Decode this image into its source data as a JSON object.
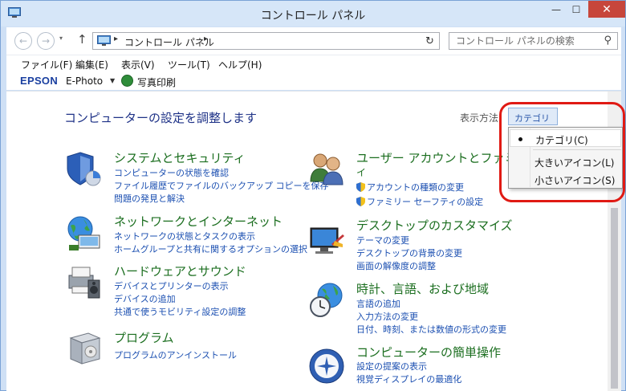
{
  "window": {
    "title": "コントロール パネル"
  },
  "title_buttons": {
    "minimize": "—",
    "maximize": "☐",
    "close": "✕"
  },
  "nav": {
    "back": "←",
    "forward": "→",
    "dropdown": "▾",
    "up": "↑",
    "refresh": "↻"
  },
  "address": {
    "sep": "▸",
    "crumb": "コントロール パネル",
    "dropdown": "▾"
  },
  "search": {
    "placeholder": "コントロール パネルの検索",
    "icon": "⚲"
  },
  "menu": [
    "ファイル(F)",
    "編集(E)",
    "表示(V)",
    "ツール(T)",
    "ヘルプ(H)"
  ],
  "epson": {
    "logo": "EPSON",
    "app": "E-Photo",
    "dropdown": "▼",
    "print": "写真印刷"
  },
  "content": {
    "title": "コンピューターの設定を調整します",
    "view_label": "表示方法:",
    "view_value": "カテゴリ",
    "view_arrow": "▼"
  },
  "categories": {
    "system": {
      "title": "システムとセキュリティ",
      "links": [
        "コンピューターの状態を確認",
        "ファイル履歴でファイルのバックアップ コピーを保存",
        "問題の発見と解決"
      ]
    },
    "network": {
      "title": "ネットワークとインターネット",
      "links": [
        "ネットワークの状態とタスクの表示",
        "ホームグループと共有に関するオプションの選択"
      ]
    },
    "hardware": {
      "title": "ハードウェアとサウンド",
      "links": [
        "デバイスとプリンターの表示",
        "デバイスの追加",
        "共通で使うモビリティ設定の調整"
      ]
    },
    "programs": {
      "title": "プログラム",
      "links": [
        "プログラムのアンインストール"
      ]
    },
    "users": {
      "title_line1": "ユーザー アカウントとファミリー セ",
      "title_line2": "イ",
      "links": [
        "アカウントの種類の変更",
        "ファミリー セーフティの設定"
      ]
    },
    "desktop": {
      "title": "デスクトップのカスタマイズ",
      "links": [
        "テーマの変更",
        "デスクトップの背景の変更",
        "画面の解像度の調整"
      ]
    },
    "clock": {
      "title": "時計、言語、および地域",
      "links": [
        "言語の追加",
        "入力方法の変更",
        "日付、時刻、または数値の形式の変更"
      ]
    },
    "ease": {
      "title": "コンピューターの簡単操作",
      "links": [
        "設定の提案の表示",
        "視覚ディスプレイの最適化"
      ]
    }
  },
  "view_menu": {
    "items": [
      "カテゴリ(C)",
      "大きいアイコン(L)",
      "小さいアイコン(S)"
    ],
    "selected": "カテゴリ(C)"
  },
  "colors": {
    "highlight": "#e01a14",
    "category_title": "#1b6e1f",
    "link": "#1b4fb1",
    "page_title": "#1e3287"
  }
}
